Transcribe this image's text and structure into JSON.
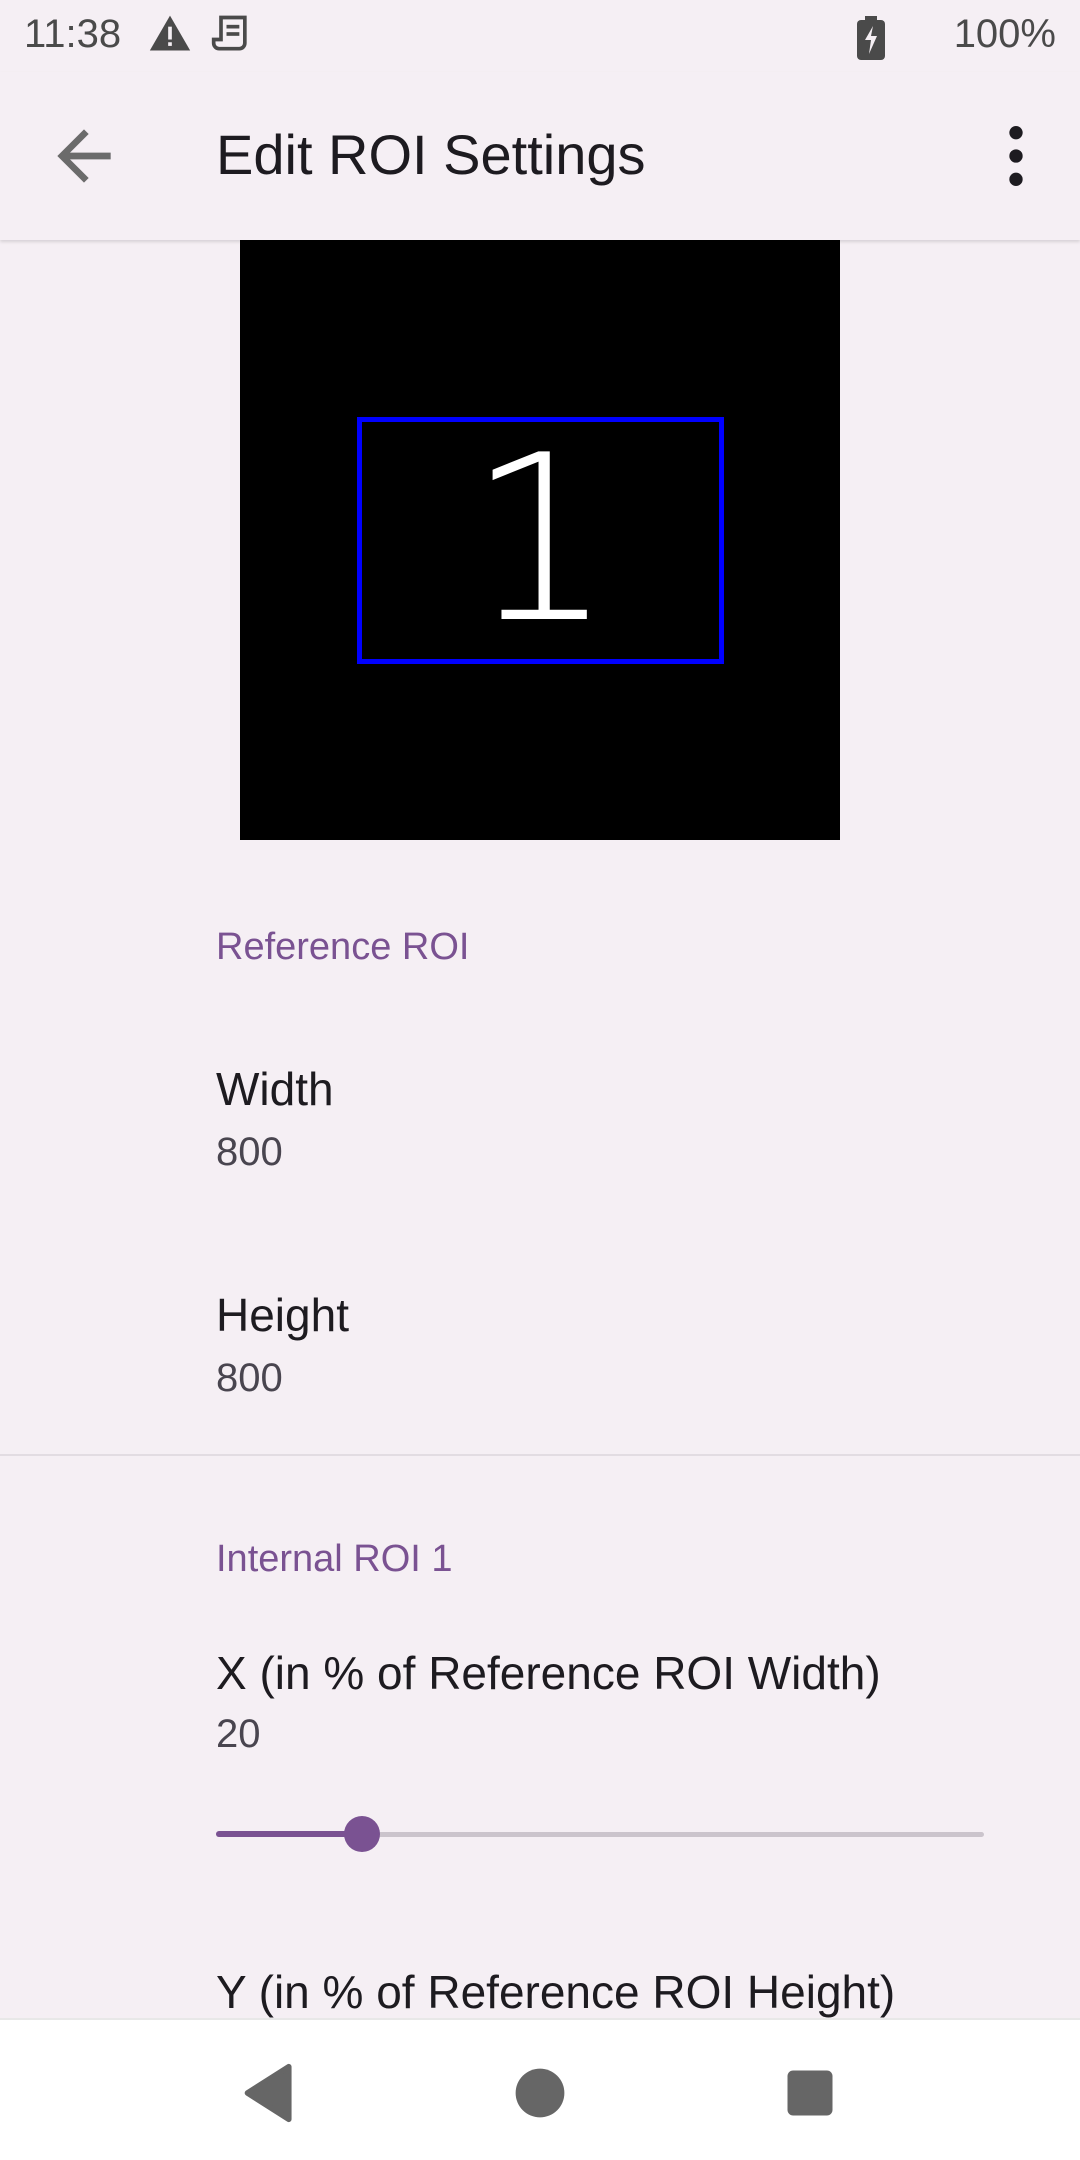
{
  "status_bar": {
    "time": "11:38",
    "battery_percent": "100%",
    "icons": [
      "warning-icon",
      "receipt-icon",
      "battery-charging-icon"
    ]
  },
  "app_bar": {
    "title": "Edit ROI Settings",
    "icons": [
      "back-arrow-icon",
      "more-vert-icon"
    ]
  },
  "preview": {
    "roi_label": "1",
    "background_color": "#000000",
    "roi_border_color": "#0000FF"
  },
  "reference_roi": {
    "header": "Reference ROI",
    "width": {
      "title": "Width",
      "value": "800"
    },
    "height": {
      "title": "Height",
      "value": "800"
    }
  },
  "internal_roi_1": {
    "header": "Internal ROI 1",
    "x": {
      "title": "X (in % of Reference ROI Width)",
      "value": "20",
      "slider_fraction": 0.19
    },
    "y": {
      "title": "Y (in % of Reference ROI Height)"
    }
  },
  "nav_bar": {
    "icons": [
      "nav-back-icon",
      "nav-home-icon",
      "nav-recents-icon"
    ]
  },
  "colors": {
    "accent": "#7A5292",
    "background": "#F5EFF4",
    "text_primary": "#1D1B20",
    "text_secondary": "#49454F"
  }
}
